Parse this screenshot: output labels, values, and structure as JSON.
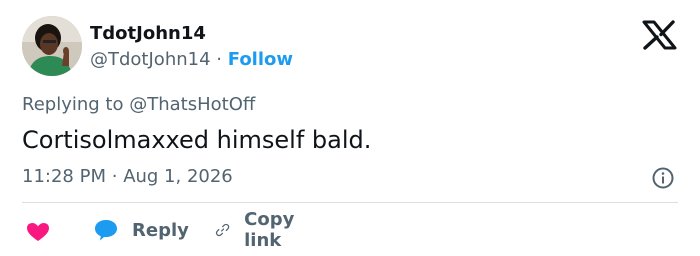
{
  "author": {
    "display_name": "TdotJohn14",
    "handle": "@TdotJohn14",
    "separator": "·",
    "follow_label": "Follow"
  },
  "tweet": {
    "replying_prefix": "Replying to",
    "replying_to": "@ThatsHotOff",
    "text": "Cortisolmaxxed himself bald.",
    "time": "11:28 PM",
    "date_separator": "·",
    "date": "Aug 1, 2026"
  },
  "actions": {
    "reply_label": "Reply",
    "copy_link_label": "Copy link"
  },
  "icons": {
    "brand": "x-logo-icon",
    "info": "info-icon",
    "like": "heart-icon",
    "reply": "speech-bubble-icon",
    "copy": "link-icon"
  },
  "colors": {
    "accent": "#1d9bf0",
    "heart": "#f91880",
    "secondary_text": "#536471",
    "primary_text": "#0f1419"
  }
}
